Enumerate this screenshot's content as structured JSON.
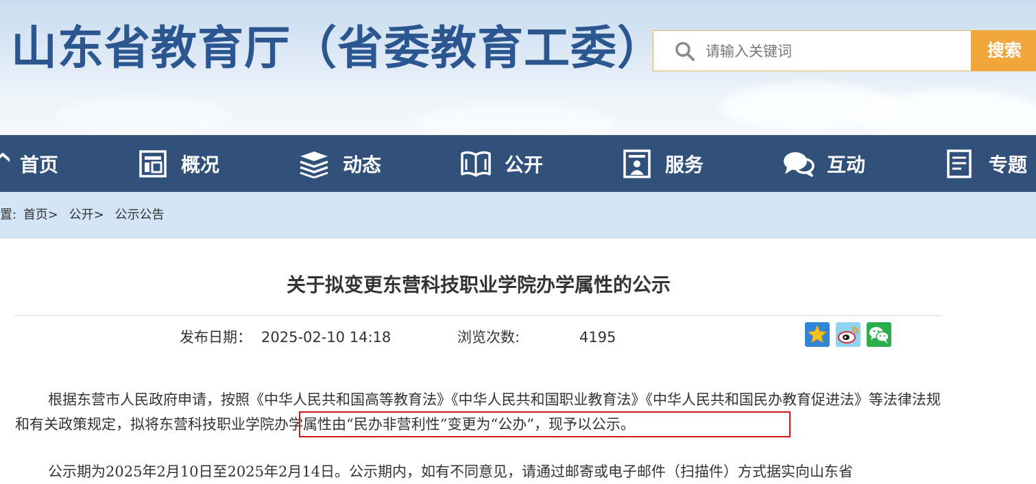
{
  "header": {
    "site_title": "山东省教育厅（省委教育工委）",
    "search": {
      "placeholder": "请输入关键词",
      "button_label": "搜索"
    }
  },
  "nav": {
    "items": [
      {
        "label": "首页",
        "icon": "home-icon"
      },
      {
        "label": "概况",
        "icon": "overview-icon"
      },
      {
        "label": "动态",
        "icon": "news-stack-icon"
      },
      {
        "label": "公开",
        "icon": "open-book-icon"
      },
      {
        "label": "服务",
        "icon": "service-icon"
      },
      {
        "label": "互动",
        "icon": "chat-bubbles-icon"
      },
      {
        "label": "专题",
        "icon": "document-icon"
      }
    ]
  },
  "breadcrumb": {
    "prefix": "置:",
    "items": [
      "首页>",
      "公开>",
      "公示公告"
    ]
  },
  "article": {
    "title": "关于拟变更东营科技职业学院办学属性的公示",
    "publish_label": "发布日期：",
    "publish_date": "2025-02-10 14:18",
    "views_label": "浏览次数:",
    "views": "4195",
    "share_icons": [
      "qzone-star-icon",
      "weibo-icon",
      "wechat-icon"
    ],
    "paragraphs": [
      "根据东营市人民政府申请，按照《中华人民共和国高等教育法》《中华人民共和国职业教育法》《中华人民共和国民办教育促进法》等法律法规和有关政策规定，拟将东营科技职业学院办学属性由“民办非营利性”变更为“公办”，现予以公示。",
      "公示期为2025年2月10日至2025年2月14日。公示期内，如有不同意见，请通过邮寄或电子邮件（扫描件）方式据实向山东省"
    ]
  },
  "colors": {
    "brand_blue": "#2c5690",
    "nav_bg": "#32517a",
    "breadcrumb_bg": "#d2e4f5",
    "search_button": "#f1a63b",
    "highlight_border": "#d01616"
  }
}
